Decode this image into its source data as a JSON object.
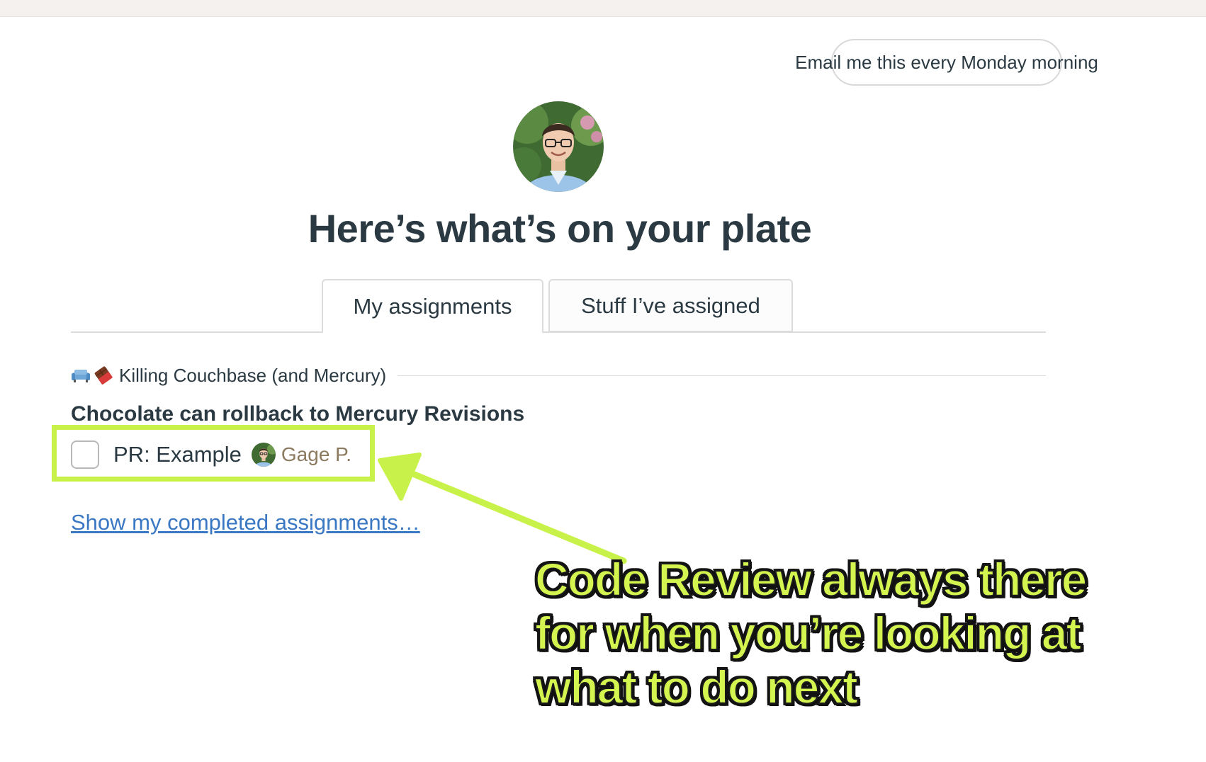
{
  "header": {
    "email_button_label": "Email me this every Monday morning"
  },
  "page_title": "Here’s what’s on your plate",
  "tabs": [
    {
      "label": "My assignments",
      "active": true
    },
    {
      "label": "Stuff I’ve assigned",
      "active": false
    }
  ],
  "project": {
    "icons": [
      "couch-icon",
      "chocolate-icon"
    ],
    "name": "Killing Couchbase (and Mercury)"
  },
  "task": {
    "title": "Chocolate can rollback to Mercury Revisions",
    "assignment": {
      "label": "PR: Example",
      "checked": false,
      "assignee": "Gage P."
    }
  },
  "completed_link": "Show my completed assignments…",
  "annotation": {
    "lines": [
      "Code Review always there",
      "for when you’re looking at",
      "what to do next"
    ],
    "color": "#c8f24a"
  }
}
